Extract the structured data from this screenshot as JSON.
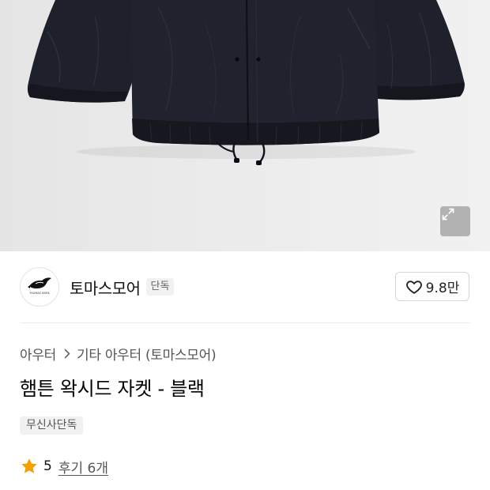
{
  "product_gallery": {
    "expand_icon": "expand-icon"
  },
  "brand": {
    "name": "토마스모어",
    "badge": "단독",
    "logo_text": "THOMAS MORE"
  },
  "like": {
    "icon": "heart-outline-icon",
    "count": "9.8만"
  },
  "breadcrumb": {
    "items": [
      "아우터",
      "기타 아우터 (토마스모어)"
    ],
    "separator_icon": "chevron-right-icon"
  },
  "product": {
    "title": "햄튼 왁시드 자켓 - 블랙",
    "badge": "무신사단독"
  },
  "rating": {
    "icon": "star-icon",
    "score": "5",
    "reviews_label": "후기 6개"
  },
  "colors": {
    "star": "#f5a000",
    "jacket": "#1e202b",
    "image_background": "#ececec"
  }
}
